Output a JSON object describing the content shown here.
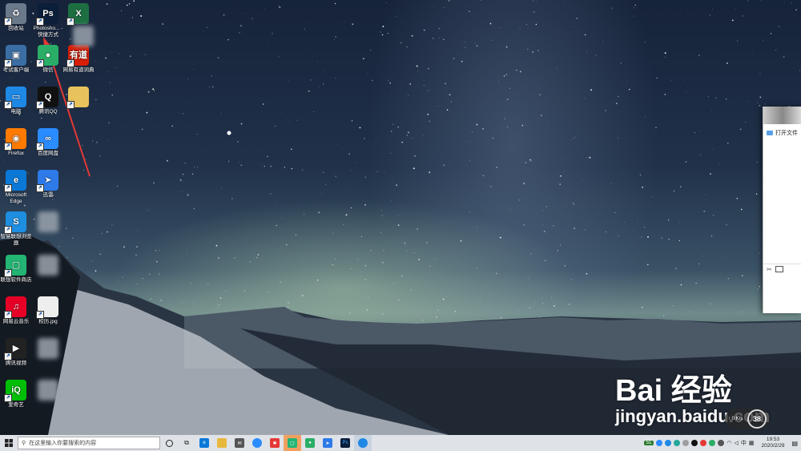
{
  "desktop_icons": [
    {
      "id": "recycle",
      "label": "回收站",
      "color": "#6a7a8a",
      "glyph": "♻"
    },
    {
      "id": "ps",
      "label": "Photosho... - 快捷方式",
      "color": "#0b1e3a",
      "glyph": "Ps"
    },
    {
      "id": "excel",
      "label": "",
      "color": "#1d6f42",
      "glyph": "X"
    },
    {
      "id": "exam",
      "label": "考试客户端",
      "color": "#3a6ea5",
      "glyph": "▣"
    },
    {
      "id": "wechat",
      "label": "微信",
      "color": "#2aae67",
      "glyph": "●"
    },
    {
      "id": "youdao",
      "label": "网易有道词典",
      "color": "#d81e06",
      "glyph": "有道"
    },
    {
      "id": "computer",
      "label": "电脑",
      "color": "#1e88e5",
      "glyph": "▭"
    },
    {
      "id": "qq",
      "label": "腾讯QQ",
      "color": "#111",
      "glyph": "Q"
    },
    {
      "id": "folder",
      "label": "",
      "color": "#e8c25c",
      "glyph": ""
    },
    {
      "id": "firefox",
      "label": "Firefox",
      "color": "#ff7a00",
      "glyph": "◉"
    },
    {
      "id": "baidupan",
      "label": "百度网盘",
      "color": "#2b8cff",
      "glyph": "∞"
    },
    {
      "id": "edge",
      "label": "Microsoft Edge",
      "color": "#0a78d7",
      "glyph": "e"
    },
    {
      "id": "xunlei",
      "label": "迅雷",
      "color": "#2d7ae8",
      "glyph": "➤"
    },
    {
      "id": "lenovo_browser",
      "label": "智慧联想浏览器",
      "color": "#1e8fe0",
      "glyph": "S"
    },
    {
      "id": "lenovo_store",
      "label": "联想软件商店",
      "color": "#22b573",
      "glyph": "▢"
    },
    {
      "id": "netease_music",
      "label": "网易云音乐",
      "color": "#e60026",
      "glyph": "♫"
    },
    {
      "id": "resume",
      "label": "校历.jpg",
      "color": "#eee",
      "glyph": ""
    },
    {
      "id": "tencent_video",
      "label": "腾讯视频",
      "color": "#222",
      "glyph": "▶"
    },
    {
      "id": "iqiyi",
      "label": "爱奇艺",
      "color": "#00be06",
      "glyph": "iQ"
    }
  ],
  "side_window": {
    "title": "打开文件"
  },
  "watermark": {
    "brand": "Bai  经验",
    "url": "jingyan.baidu.com"
  },
  "net_badge": {
    "speed": "↑ 0 K/s",
    "percent": "38"
  },
  "taskbar": {
    "search_placeholder": "在这里输入你要搜索的内容",
    "time": "19:53",
    "date": "2020/2/29",
    "ime": "中",
    "battery": "51"
  }
}
